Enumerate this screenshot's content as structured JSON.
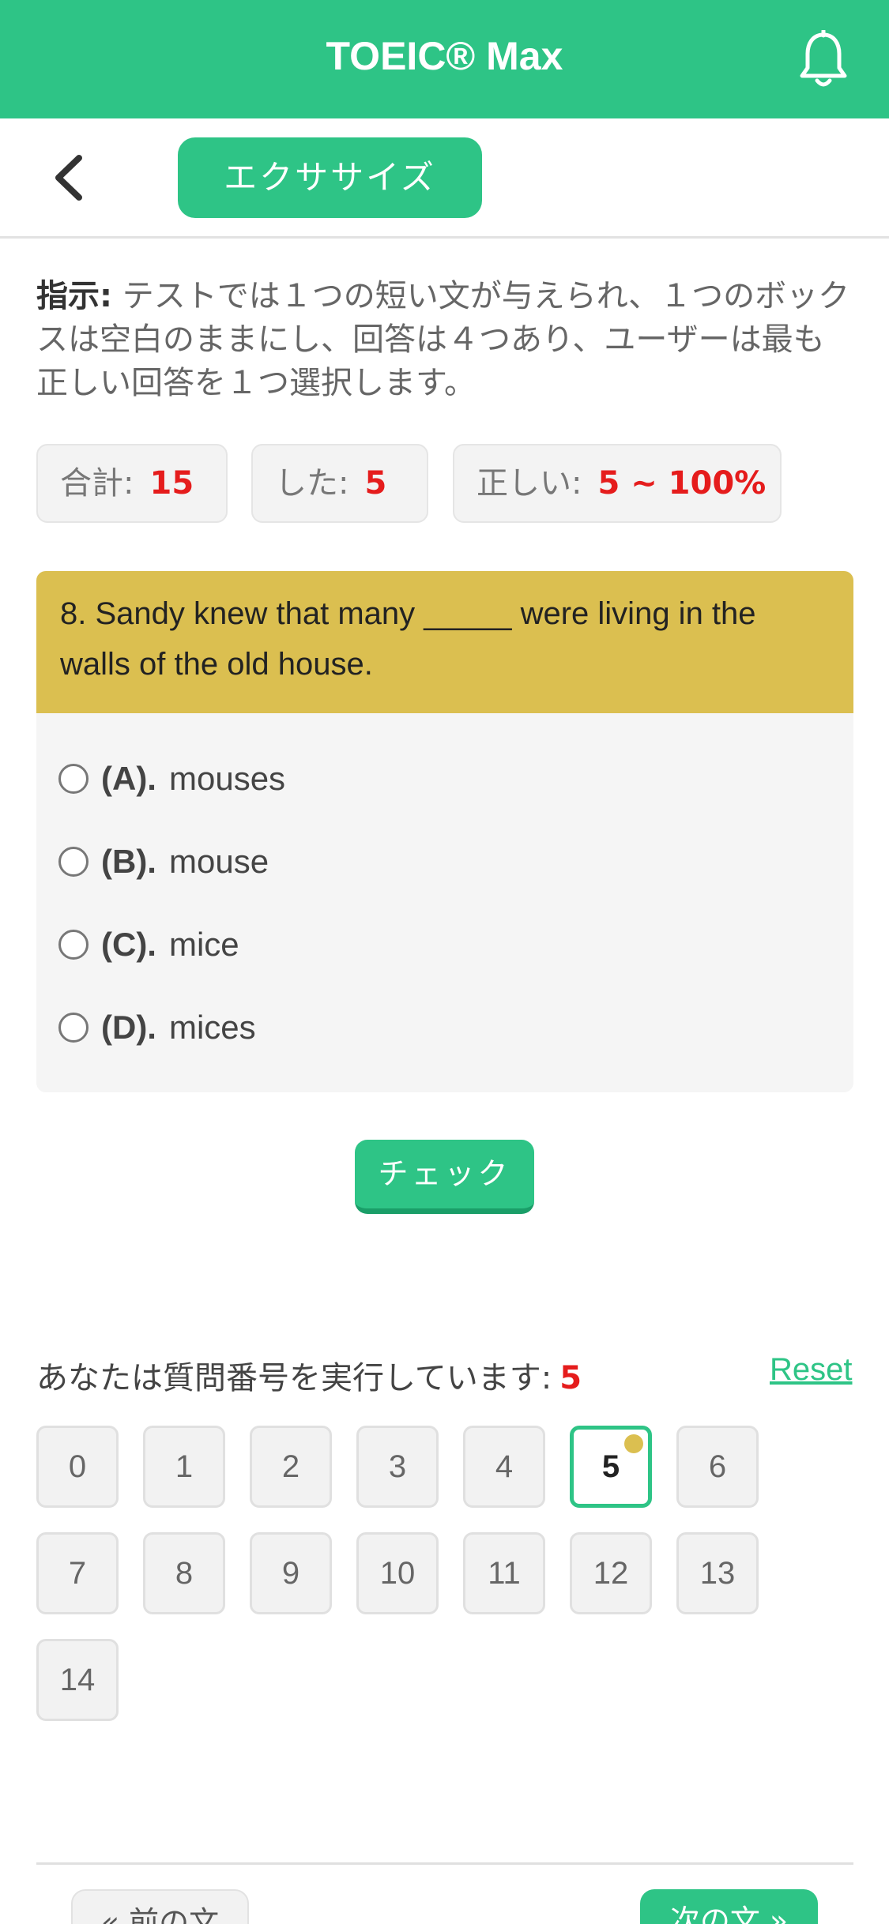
{
  "header": {
    "title": "TOEIC® Max",
    "icon": "bell-icon"
  },
  "subbar": {
    "back_icon": "chevron-left-icon",
    "exercise_label": "エクササイズ"
  },
  "instructions": {
    "label": "指示:",
    "text": " テストでは１つの短い文が与えられ、１つのボックスは空白のままにし、回答は４つあり、ユーザーは最も正しい回答を１つ選択します。"
  },
  "stats": {
    "total_label": "合計:",
    "total_value": "15",
    "done_label": "した:",
    "done_value": "5",
    "correct_label": "正しい:",
    "correct_value": "5 ~ 100%"
  },
  "question": {
    "text": "8. Sandy knew that many _____ were living in the walls of the old house.",
    "options": [
      {
        "letter": "(A).",
        "text": "mouses"
      },
      {
        "letter": "(B).",
        "text": "mouse"
      },
      {
        "letter": "(C).",
        "text": "mice"
      },
      {
        "letter": "(D).",
        "text": "mices"
      }
    ]
  },
  "check_label": "チェック",
  "progress": {
    "label": "あなたは質問番号を実行しています:",
    "current": "5",
    "reset_label": "Reset",
    "numbers": [
      "0",
      "1",
      "2",
      "3",
      "4",
      "5",
      "6",
      "7",
      "8",
      "9",
      "10",
      "11",
      "12",
      "13",
      "14"
    ]
  },
  "nav": {
    "prev_label": "« 前の文",
    "next_label": "次の文 »"
  },
  "colors": {
    "brand": "#2ec486",
    "question_bg": "#dbbf50",
    "highlight": "#e51c1c"
  }
}
